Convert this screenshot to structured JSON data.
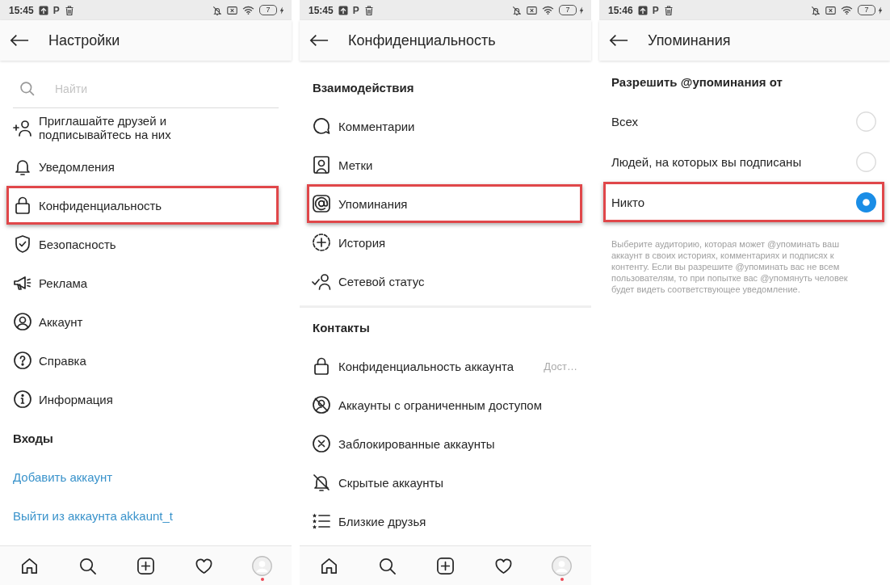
{
  "screens": [
    {
      "status_bar": {
        "time": "15:45",
        "glyph": "P",
        "battery": "7"
      },
      "header": {
        "title": "Настройки"
      },
      "search": {
        "placeholder": "Найти"
      },
      "sections": [
        {
          "items": [
            {
              "kind": "menu",
              "label": "Приглашайте друзей и подписывайтесь на них",
              "highlighted": false
            },
            {
              "kind": "menu",
              "label": "Уведомления",
              "highlighted": false
            },
            {
              "kind": "menu",
              "label": "Конфиденциальность",
              "highlighted": true
            },
            {
              "kind": "menu",
              "label": "Безопасность",
              "highlighted": false
            },
            {
              "kind": "menu",
              "label": "Реклама",
              "highlighted": false
            },
            {
              "kind": "menu",
              "label": "Аккаунт",
              "highlighted": false
            },
            {
              "kind": "menu",
              "label": "Справка",
              "highlighted": false
            },
            {
              "kind": "menu",
              "label": "Информация",
              "highlighted": false
            }
          ]
        },
        {
          "title": "Входы",
          "items": [
            {
              "kind": "link",
              "label": "Добавить аккаунт",
              "highlighted": false
            },
            {
              "kind": "link",
              "label": "Выйти из аккаунта akkaunt_t",
              "highlighted": false
            }
          ]
        }
      ],
      "bottom_nav": {
        "notification_dot": true
      }
    },
    {
      "status_bar": {
        "time": "15:45",
        "glyph": "P",
        "battery": "7"
      },
      "header": {
        "title": "Конфиденциальность"
      },
      "sections": [
        {
          "title": "Взаимодействия",
          "items": [
            {
              "kind": "menu",
              "label": "Комментарии",
              "highlighted": false
            },
            {
              "kind": "menu",
              "label": "Метки",
              "highlighted": false
            },
            {
              "kind": "menu",
              "label": "Упоминания",
              "highlighted": true
            },
            {
              "kind": "menu",
              "label": "История",
              "highlighted": false
            },
            {
              "kind": "menu",
              "label": "Сетевой статус",
              "highlighted": false
            }
          ]
        },
        {
          "title": "Контакты",
          "items": [
            {
              "kind": "menu",
              "label": "Конфиденциальность аккаунта",
              "value": "Дост…",
              "highlighted": false
            },
            {
              "kind": "menu",
              "label": "Аккаунты с ограниченным доступом",
              "highlighted": false
            },
            {
              "kind": "menu",
              "label": "Заблокированные аккаунты",
              "highlighted": false
            },
            {
              "kind": "menu",
              "label": "Скрытые аккаунты",
              "highlighted": false
            },
            {
              "kind": "menu",
              "label": "Близкие друзья",
              "highlighted": false
            }
          ]
        }
      ],
      "bottom_nav": {
        "notification_dot": true
      }
    },
    {
      "status_bar": {
        "time": "15:46",
        "glyph": "P",
        "battery": "7"
      },
      "header": {
        "title": "Упоминания"
      },
      "sections": [
        {
          "title": "Разрешить @упоминания от",
          "items": [
            {
              "kind": "radio",
              "label": "Всех",
              "selected": false,
              "highlighted": false
            },
            {
              "kind": "radio",
              "label": "Людей, на которых вы подписаны",
              "selected": false,
              "highlighted": false
            },
            {
              "kind": "radio",
              "label": "Никто",
              "selected": true,
              "highlighted": true
            }
          ]
        }
      ],
      "note": "Выберите аудиторию, которая может @упоминать ваш аккаунт в своих историях, комментариях и подписях к контенту. Если вы разрешите @упоминать вас не всем пользователям, то при попытке вас @упомянуть человек будет видеть соответствующее уведомление."
    }
  ]
}
